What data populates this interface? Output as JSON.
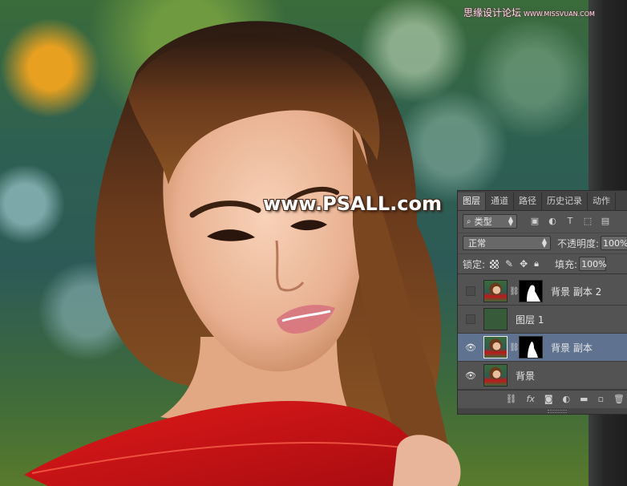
{
  "watermark_top": "思缘设计论坛",
  "watermark_top_small": "WWW.MISSVUAN.COM",
  "watermark_mid": "www.PSALL.com",
  "panel": {
    "tabs": [
      "图层",
      "通道",
      "路径",
      "历史记录",
      "动作"
    ],
    "active_tab": "图层",
    "filter_kind_label": "类型",
    "filter_icons": [
      "image-filter-icon",
      "adjustment-filter-icon",
      "type-filter-icon",
      "shape-filter-icon",
      "smart-object-filter-icon"
    ],
    "blend_mode": "正常",
    "opacity_label": "不透明度:",
    "opacity_value": "100%",
    "lock_label": "锁定:",
    "fill_label": "填充:",
    "fill_value": "100%",
    "layers": [
      {
        "name": "背景 副本 2",
        "visible": false,
        "has_mask": true,
        "selected": false
      },
      {
        "name": "图层 1",
        "visible": false,
        "has_mask": false,
        "selected": false
      },
      {
        "name": "背景 副本",
        "visible": true,
        "has_mask": true,
        "selected": true
      },
      {
        "name": "背景",
        "visible": true,
        "has_mask": false,
        "selected": false
      }
    ],
    "footer_icons": [
      "link-layers-icon",
      "fx-icon",
      "add-mask-icon",
      "adjustment-layer-icon",
      "new-group-icon",
      "new-layer-icon",
      "trash-icon"
    ],
    "footer_fx": "fx"
  }
}
